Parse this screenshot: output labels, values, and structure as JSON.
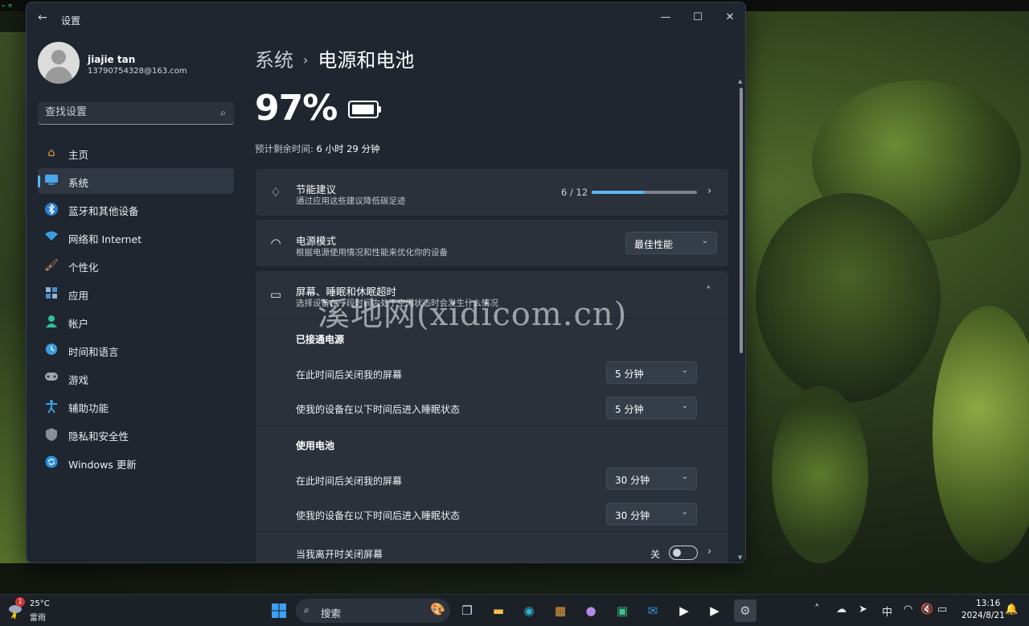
{
  "window": {
    "title": "设置"
  },
  "profile": {
    "name": "jiajie tan",
    "email": "13790754328@163.com"
  },
  "search": {
    "placeholder": "查找设置"
  },
  "sidebar": {
    "items": [
      {
        "label": "主页",
        "icon": "home-icon"
      },
      {
        "label": "系统",
        "icon": "system-icon",
        "active": true
      },
      {
        "label": "蓝牙和其他设备",
        "icon": "bluetooth-icon"
      },
      {
        "label": "网络和 Internet",
        "icon": "wifi-icon"
      },
      {
        "label": "个性化",
        "icon": "brush-icon"
      },
      {
        "label": "应用",
        "icon": "apps-icon"
      },
      {
        "label": "帐户",
        "icon": "account-icon"
      },
      {
        "label": "时间和语言",
        "icon": "clock-globe-icon"
      },
      {
        "label": "游戏",
        "icon": "gamepad-icon"
      },
      {
        "label": "辅助功能",
        "icon": "accessibility-icon"
      },
      {
        "label": "隐私和安全性",
        "icon": "shield-icon"
      },
      {
        "label": "Windows 更新",
        "icon": "update-icon"
      }
    ]
  },
  "breadcrumb": {
    "parent": "系统",
    "current": "电源和电池"
  },
  "battery": {
    "percent": "97%",
    "level": 0.97,
    "remaining_label": "预计剩余时间:",
    "remaining_value": "6 小时 29 分钟"
  },
  "energy_recommendations": {
    "title": "节能建议",
    "subtitle": "通过应用这些建议降低碳足迹",
    "progress_text": "6 / 12",
    "progress_fraction": 0.5
  },
  "power_mode": {
    "title": "电源模式",
    "subtitle": "根据电源使用情况和性能来优化你的设备",
    "selected": "最佳性能"
  },
  "screen_sleep": {
    "title": "屏幕、睡眠和休眠超时",
    "subtitle": "选择设备在一段时间内处于空闲状态时会发生什么情况",
    "plugged_in": {
      "heading": "已接通电源",
      "screen_label": "在此时间后关闭我的屏幕",
      "screen_value": "5 分钟",
      "sleep_label": "使我的设备在以下时间后进入睡眠状态",
      "sleep_value": "5 分钟"
    },
    "on_battery": {
      "heading": "使用电池",
      "screen_label": "在此时间后关闭我的屏幕",
      "screen_value": "30 分钟",
      "sleep_label": "使我的设备在以下时间后进入睡眠状态",
      "sleep_value": "30 分钟"
    }
  },
  "presence": {
    "title": "当我离开时关闭屏幕",
    "toggle_label": "关",
    "toggle_on": false
  },
  "watermark": "溪地网(xidicom.cn)",
  "taskbar": {
    "weather_temp": "25°C",
    "weather_desc": "雷雨",
    "weather_badge": "1",
    "search_label": "搜索",
    "ime": "中",
    "clock_time": "13:16",
    "clock_date": "2024/8/21"
  },
  "colors": {
    "accent": "#5db6f5",
    "window_bg": "#1f2630",
    "card_bg": "#2a313b"
  }
}
